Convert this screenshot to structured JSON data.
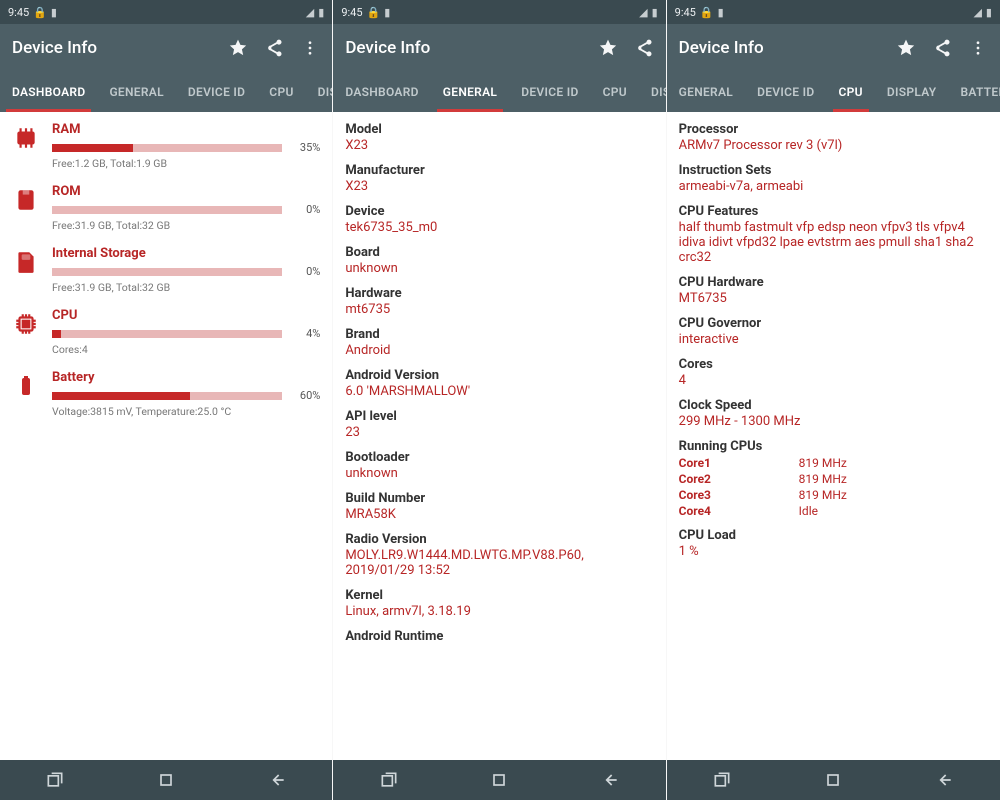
{
  "status": {
    "time": "9:45"
  },
  "actionbar": {
    "title": "Device Info"
  },
  "pane1": {
    "tabs": [
      "DASHBOARD",
      "GENERAL",
      "DEVICE ID",
      "CPU",
      "DISPLAY"
    ],
    "active": 0,
    "items": [
      {
        "title": "RAM",
        "pct": "35%",
        "fill": 35,
        "sub": "Free:1.2 GB,   Total:1.9 GB"
      },
      {
        "title": "ROM",
        "pct": "0%",
        "fill": 0,
        "sub": "Free:31.9 GB,   Total:32 GB"
      },
      {
        "title": "Internal Storage",
        "pct": "0%",
        "fill": 0,
        "sub": "Free:31.9 GB,   Total:32 GB"
      },
      {
        "title": "CPU",
        "pct": "4%",
        "fill": 4,
        "sub": "Cores:4"
      },
      {
        "title": "Battery",
        "pct": "60%",
        "fill": 60,
        "sub": "Voltage:3815 mV,   Temperature:25.0 °C"
      }
    ]
  },
  "pane2": {
    "tabs": [
      "DASHBOARD",
      "GENERAL",
      "DEVICE ID",
      "CPU",
      "DIS"
    ],
    "active": 1,
    "items": [
      {
        "l": "Model",
        "v": "X23"
      },
      {
        "l": "Manufacturer",
        "v": "X23"
      },
      {
        "l": "Device",
        "v": "tek6735_35_m0"
      },
      {
        "l": "Board",
        "v": "unknown"
      },
      {
        "l": "Hardware",
        "v": "mt6735"
      },
      {
        "l": "Brand",
        "v": "Android"
      },
      {
        "l": "Android Version",
        "v": "6.0 'MARSHMALLOW'"
      },
      {
        "l": "API level",
        "v": "23"
      },
      {
        "l": "Bootloader",
        "v": "unknown"
      },
      {
        "l": "Build Number",
        "v": "MRA58K"
      },
      {
        "l": "Radio Version",
        "v": "MOLY.LR9.W1444.MD.LWTG.MP.V88.P60, 2019/01/29 13:52"
      },
      {
        "l": "Kernel",
        "v": "Linux, armv7l, 3.18.19"
      },
      {
        "l": "Android Runtime",
        "v": ""
      }
    ]
  },
  "pane3": {
    "tabs": [
      "GENERAL",
      "DEVICE ID",
      "CPU",
      "DISPLAY",
      "BATTERY"
    ],
    "active": 2,
    "items": [
      {
        "l": "Processor",
        "v": "ARMv7 Processor rev 3 (v7l)"
      },
      {
        "l": "Instruction Sets",
        "v": "armeabi-v7a, armeabi"
      },
      {
        "l": "CPU Features",
        "v": "half thumb fastmult vfp edsp neon vfpv3 tls vfpv4 idiva idivt vfpd32 lpae evtstrm aes pmull sha1 sha2 crc32"
      },
      {
        "l": "CPU Hardware",
        "v": "MT6735"
      },
      {
        "l": "CPU Governor",
        "v": "interactive"
      },
      {
        "l": "Cores",
        "v": "4"
      },
      {
        "l": "Clock Speed",
        "v": "299 MHz - 1300 MHz"
      }
    ],
    "running_label": "Running CPUs",
    "running": [
      {
        "core": "Core1",
        "val": "819 MHz"
      },
      {
        "core": "Core2",
        "val": "819 MHz"
      },
      {
        "core": "Core3",
        "val": "819 MHz"
      },
      {
        "core": "Core4",
        "val": "Idle"
      }
    ],
    "load": {
      "l": "CPU Load",
      "v": "1 %"
    }
  }
}
